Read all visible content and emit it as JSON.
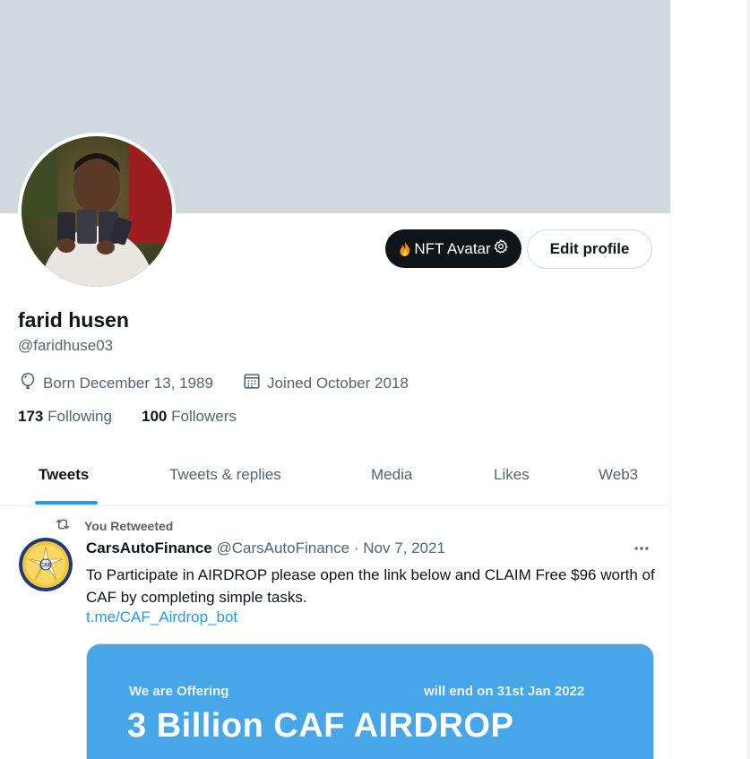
{
  "profile": {
    "display_name": "farid husen",
    "handle": "@faridhuse03",
    "born": "Born December 13, 1989",
    "joined": "Joined October 2018",
    "following_count": "173",
    "following_label": "Following",
    "followers_count": "100",
    "followers_label": "Followers"
  },
  "buttons": {
    "nft_avatar": "NFT Avatar",
    "edit_profile": "Edit profile"
  },
  "tabs": [
    {
      "label": "Tweets"
    },
    {
      "label": "Tweets & replies"
    },
    {
      "label": "Media"
    },
    {
      "label": "Likes"
    },
    {
      "label": "Web3"
    }
  ],
  "tweet": {
    "retweet_label": "You Retweeted",
    "author_name": "CarsAutoFinance",
    "author_handle": "@CarsAutoFinance",
    "separator": "·",
    "date": "Nov 7, 2021",
    "text": "To Participate in AIRDROP please open the link below and CLAIM Free $96 worth of CAF by completing simple tasks.",
    "link": "t.me/CAF_Airdrop_bot",
    "avatar_text": "CAF",
    "media": {
      "offer": "We are Offering",
      "end": "will end on 31st Jan 2022",
      "headline": "3 Billion CAF AIRDROP"
    }
  },
  "icons": {
    "balloon": "balloon-icon",
    "calendar": "calendar-icon",
    "retweet": "retweet-icon",
    "more": "more-icon",
    "gear": "gear-icon",
    "fire": "fire-icon"
  },
  "colors": {
    "accent": "#1d9bf0",
    "banner": "#cfd9de",
    "text_primary": "#0f1419",
    "text_secondary": "#536471",
    "media_bg": "#47a6e8"
  }
}
